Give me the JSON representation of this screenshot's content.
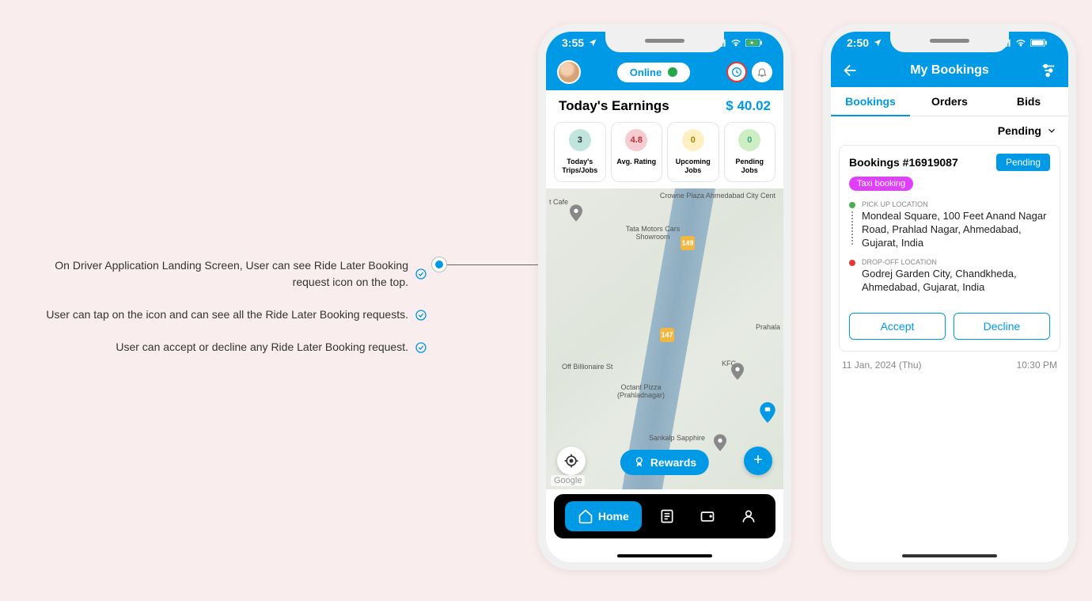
{
  "notes": [
    "On Driver Application Landing Screen, User can see Ride Later Booking request icon on the top.",
    "User can tap on the icon and can see all the Ride Later Booking requests.",
    "User can accept or decline any Ride Later Booking request."
  ],
  "phone1": {
    "status_time": "3:55",
    "online_label": "Online",
    "earnings_title": "Today's Earnings",
    "earnings_value": "$ 40.02",
    "stats": [
      {
        "value": "3",
        "label": "Today's Trips/Jobs",
        "bg": "#bfe5dc",
        "color": "#333"
      },
      {
        "value": "4.8",
        "label": "Avg. Rating",
        "bg": "#f7cbd2",
        "color": "#b33"
      },
      {
        "value": "0",
        "label": "Upcoming Jobs",
        "bg": "#fff0c2",
        "color": "#a98600"
      },
      {
        "value": "0",
        "label": "Pending Jobs",
        "bg": "#cceec2",
        "color": "#3a8"
      }
    ],
    "map": {
      "labels": {
        "crowne": "Crowne Plaza Ahmedabad City Cent",
        "tata": "Tata Motors Cars Showroom",
        "billionaire": "Off Billionaire St",
        "octant": "Octant Pizza (Prahladnagar)",
        "sankalp": "Sankalp Sapphire",
        "kfc": "KFC",
        "prahala": "Prahala",
        "cafe": "t Cafe"
      },
      "markers": {
        "m1": "149",
        "m2": "147"
      },
      "google": "Google"
    },
    "rewards_label": "Rewards",
    "nav_home": "Home"
  },
  "phone2": {
    "status_time": "2:50",
    "title": "My Bookings",
    "tabs": [
      "Bookings",
      "Orders",
      "Bids"
    ],
    "filter": "Pending",
    "booking": {
      "id": "Bookings #16919087",
      "status": "Pending",
      "type": "Taxi booking",
      "pickup_label": "PICK UP LOCATION",
      "pickup_text": "Mondeal Square, 100 Feet Anand Nagar Road, Prahlad Nagar, Ahmedabad, Gujarat, India",
      "dropoff_label": "DROP-OFF LOCATION",
      "dropoff_text": "Godrej Garden City, Chandkheda, Ahmedabad, Gujarat, India",
      "accept": "Accept",
      "decline": "Decline",
      "date": "11 Jan, 2024 (Thu)",
      "time": "10:30 PM"
    }
  }
}
